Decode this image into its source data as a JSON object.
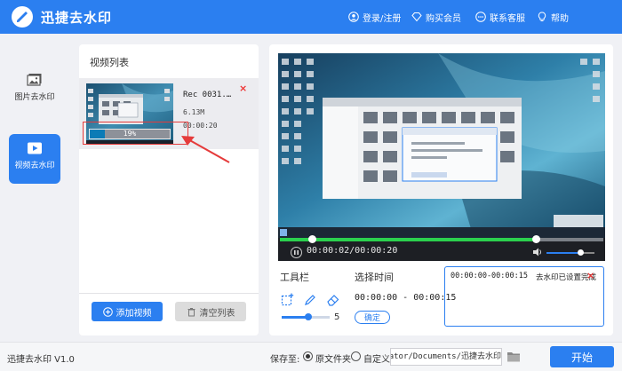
{
  "app": {
    "title": "迅捷去水印",
    "version": "迅捷去水印 V1.0"
  },
  "topbar": {
    "login": "登录/注册",
    "vip": "购买会员",
    "contact": "联系客服",
    "help": "帮助"
  },
  "sidebar": {
    "items": [
      {
        "label": "图片去水印",
        "icon": "image-icon",
        "active": false
      },
      {
        "label": "视频去水印",
        "icon": "video-icon",
        "active": true
      }
    ]
  },
  "video_list": {
    "title": "视频列表",
    "items": [
      {
        "name": "Rec 0031.…",
        "size": "6.13M",
        "duration": "00:00:20",
        "progress_text": "19%",
        "progress": 0.19
      }
    ],
    "add_label": "添加视频",
    "clear_label": "清空列表"
  },
  "player": {
    "time": "00:00:02/00:00:20",
    "playhead": 0.1,
    "selection_end": 0.79,
    "volume": 0.7
  },
  "toolbar": {
    "title": "工具栏",
    "brush_size": "5",
    "brush_level": 0.55,
    "tools": [
      "select-rect-icon",
      "brush-icon",
      "eraser-icon"
    ]
  },
  "time_select": {
    "title": "选择时间",
    "range": "00:00:00 - 00:00:15",
    "confirm_label": "确定"
  },
  "status": {
    "time": "00:00:00-00:00:15",
    "message": "去水印已设置完成"
  },
  "footer": {
    "save_label": "保存至:",
    "option_source": "原文件夹",
    "option_custom": "自定义",
    "path": "C:/Users/Administrator/Documents/迅捷去水印",
    "start_label": "开始"
  },
  "colors": {
    "accent": "#2b7ff0",
    "progress_green": "#2bd14e",
    "delete_red": "#e33333"
  }
}
